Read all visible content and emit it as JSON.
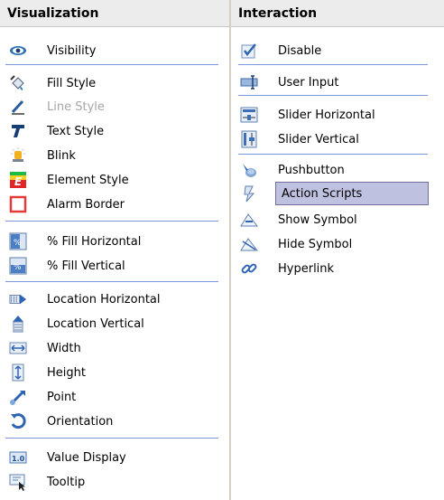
{
  "visualization": {
    "title": "Visualization",
    "items": [
      {
        "label": "Visibility",
        "icon": "eye-icon"
      },
      {
        "label": "Fill Style",
        "icon": "paint-bucket-icon"
      },
      {
        "label": "Line Style",
        "icon": "pen-line-icon",
        "disabled": true
      },
      {
        "label": "Text Style",
        "icon": "text-style-icon"
      },
      {
        "label": "Blink",
        "icon": "blink-light-icon"
      },
      {
        "label": "Element Style",
        "icon": "element-style-icon"
      },
      {
        "label": "Alarm Border",
        "icon": "alarm-border-icon"
      },
      {
        "label": "% Fill Horizontal",
        "icon": "percent-fill-horizontal-icon"
      },
      {
        "label": "% Fill Vertical",
        "icon": "percent-fill-vertical-icon"
      },
      {
        "label": "Location Horizontal",
        "icon": "location-horizontal-icon"
      },
      {
        "label": "Location Vertical",
        "icon": "location-vertical-icon"
      },
      {
        "label": "Width",
        "icon": "width-icon"
      },
      {
        "label": "Height",
        "icon": "height-icon"
      },
      {
        "label": "Point",
        "icon": "point-icon"
      },
      {
        "label": "Orientation",
        "icon": "orientation-icon"
      },
      {
        "label": "Value Display",
        "icon": "value-display-icon"
      },
      {
        "label": "Tooltip",
        "icon": "tooltip-icon"
      }
    ]
  },
  "interaction": {
    "title": "Interaction",
    "items": [
      {
        "label": "Disable",
        "icon": "disable-checkbox-icon"
      },
      {
        "label": "User Input",
        "icon": "user-input-icon"
      },
      {
        "label": "Slider Horizontal",
        "icon": "slider-horizontal-icon"
      },
      {
        "label": "Slider Vertical",
        "icon": "slider-vertical-icon"
      },
      {
        "label": "Pushbutton",
        "icon": "pushbutton-icon"
      },
      {
        "label": "Action Scripts",
        "icon": "action-scripts-icon",
        "selected": true
      },
      {
        "label": "Show Symbol",
        "icon": "show-symbol-icon"
      },
      {
        "label": "Hide Symbol",
        "icon": "hide-symbol-icon"
      },
      {
        "label": "Hyperlink",
        "icon": "hyperlink-icon"
      }
    ]
  },
  "colors": {
    "header_bg": "#ececec",
    "separator": "#7a96df",
    "selected_bg": "#bfc1e0",
    "disabled_text": "#a6a6a6"
  }
}
